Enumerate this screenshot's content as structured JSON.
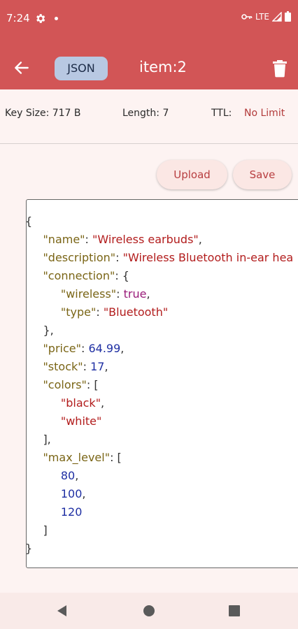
{
  "status": {
    "time": "7:24",
    "network": "LTE"
  },
  "header": {
    "type_badge": "JSON",
    "key_name": "item:2"
  },
  "info": {
    "key_size": "Key Size: 717 B",
    "length": "Length: 7",
    "ttl_label": "TTL:",
    "ttl_value": "No Limit"
  },
  "actions": {
    "upload_label": "Upload",
    "save_label": "Save"
  },
  "editor": {
    "lines": [
      {
        "indent": 0,
        "tokens": [
          [
            "p",
            "{"
          ]
        ]
      },
      {
        "indent": 1,
        "tokens": [
          [
            "k",
            "\"name\""
          ],
          [
            "p",
            ": "
          ],
          [
            "s",
            "\"Wireless earbuds\""
          ],
          [
            "p",
            ","
          ]
        ]
      },
      {
        "indent": 1,
        "tokens": [
          [
            "k",
            "\"description\""
          ],
          [
            "p",
            ": "
          ],
          [
            "s",
            "\"Wireless Bluetooth in-ear hea"
          ]
        ]
      },
      {
        "indent": 1,
        "tokens": [
          [
            "k",
            "\"connection\""
          ],
          [
            "p",
            ": {"
          ]
        ]
      },
      {
        "indent": 2,
        "tokens": [
          [
            "k",
            "\"wireless\""
          ],
          [
            "p",
            ": "
          ],
          [
            "b",
            "true"
          ],
          [
            "p",
            ","
          ]
        ]
      },
      {
        "indent": 2,
        "tokens": [
          [
            "k",
            "\"type\""
          ],
          [
            "p",
            ": "
          ],
          [
            "s",
            "\"Bluetooth\""
          ]
        ]
      },
      {
        "indent": 1,
        "tokens": [
          [
            "p",
            "},"
          ]
        ]
      },
      {
        "indent": 1,
        "tokens": [
          [
            "k",
            "\"price\""
          ],
          [
            "p",
            ": "
          ],
          [
            "n",
            "64.99"
          ],
          [
            "p",
            ","
          ]
        ]
      },
      {
        "indent": 1,
        "tokens": [
          [
            "k",
            "\"stock\""
          ],
          [
            "p",
            ": "
          ],
          [
            "n",
            "17"
          ],
          [
            "p",
            ","
          ]
        ]
      },
      {
        "indent": 1,
        "tokens": [
          [
            "k",
            "\"colors\""
          ],
          [
            "p",
            ": ["
          ]
        ]
      },
      {
        "indent": 2,
        "tokens": [
          [
            "s",
            "\"black\""
          ],
          [
            "p",
            ","
          ]
        ]
      },
      {
        "indent": 2,
        "tokens": [
          [
            "s",
            "\"white\""
          ]
        ]
      },
      {
        "indent": 1,
        "tokens": [
          [
            "p",
            "],"
          ]
        ]
      },
      {
        "indent": 1,
        "tokens": [
          [
            "k",
            "\"max_level\""
          ],
          [
            "p",
            ": ["
          ]
        ]
      },
      {
        "indent": 2,
        "tokens": [
          [
            "n",
            "80"
          ],
          [
            "p",
            ","
          ]
        ]
      },
      {
        "indent": 2,
        "tokens": [
          [
            "n",
            "100"
          ],
          [
            "p",
            ","
          ]
        ]
      },
      {
        "indent": 2,
        "tokens": [
          [
            "n",
            "120"
          ]
        ]
      },
      {
        "indent": 1,
        "tokens": [
          [
            "p",
            "]"
          ]
        ]
      },
      {
        "indent": 0,
        "tokens": [
          [
            "p",
            "}"
          ]
        ]
      }
    ]
  },
  "colors": {
    "primary": "#d25556",
    "accent_text": "#b83e40",
    "badge_bg": "#b8c8e2"
  }
}
